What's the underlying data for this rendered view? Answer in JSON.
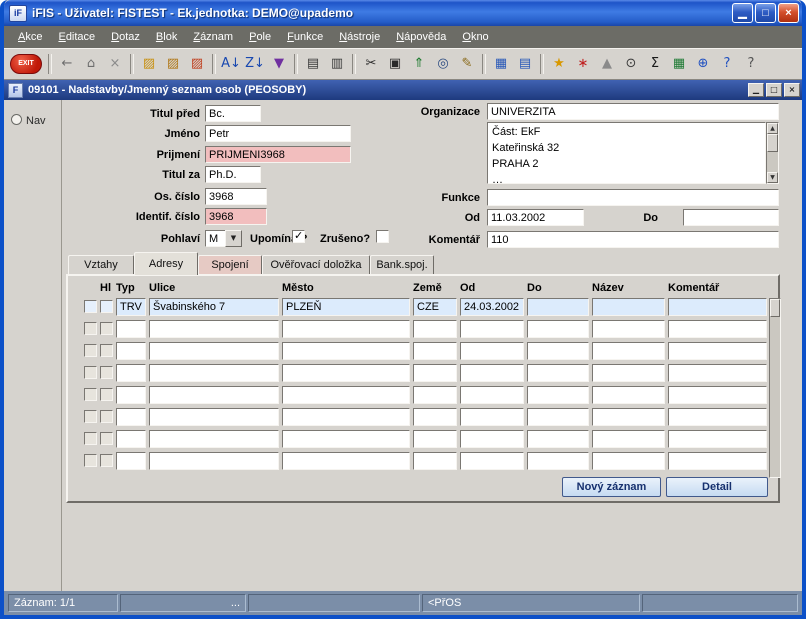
{
  "window": {
    "icon": "iF",
    "title": "iFIS - Uživatel: FISTEST - Ek.jednotka: DEMO@upademo",
    "minimize": "▁",
    "maximize": "□",
    "close": "×"
  },
  "menu": {
    "items": [
      "Akce",
      "Editace",
      "Dotaz",
      "Blok",
      "Záznam",
      "Pole",
      "Funkce",
      "Nástroje",
      "Nápověda",
      "Okno"
    ]
  },
  "toolbar": {
    "items": [
      {
        "name": "exit-button",
        "kind": "exit",
        "label": "EXIT"
      },
      {
        "sep": true
      },
      {
        "name": "back-icon",
        "glyph": "←",
        "color": "#6E6E6E"
      },
      {
        "name": "home-icon",
        "glyph": "⌂",
        "color": "#6E6E6E"
      },
      {
        "name": "clear-record-icon",
        "glyph": "×",
        "color": "#8A8A8A"
      },
      {
        "sep": true
      },
      {
        "name": "open-folder-icon",
        "glyph": "▨",
        "color": "#C89010"
      },
      {
        "name": "import-folder-icon",
        "glyph": "▨",
        "color": "#B07818"
      },
      {
        "name": "delete-folder-icon",
        "glyph": "▨",
        "color": "#C04020"
      },
      {
        "sep": true
      },
      {
        "name": "sort-asc-icon",
        "glyph": "A↓",
        "color": "#1848B0"
      },
      {
        "name": "sort-desc-icon",
        "glyph": "Z↓",
        "color": "#1848B0"
      },
      {
        "name": "filter-icon",
        "glyph": "▼",
        "color": "#7030A0"
      },
      {
        "sep": true
      },
      {
        "name": "print-icon",
        "glyph": "▤",
        "color": "#3A3A3A"
      },
      {
        "name": "print-setup-icon",
        "glyph": "▥",
        "color": "#3A3A3A"
      },
      {
        "sep": true
      },
      {
        "name": "cut-icon",
        "glyph": "✂",
        "color": "#2A2A2A"
      },
      {
        "name": "copy-icon",
        "glyph": "▣",
        "color": "#2A2A2A"
      },
      {
        "name": "paste-icon",
        "glyph": "⇑",
        "color": "#1E7A2E"
      },
      {
        "name": "zoom-icon",
        "glyph": "◎",
        "color": "#2A4A80"
      },
      {
        "name": "edit-icon",
        "glyph": "✎",
        "color": "#8A6A1A"
      },
      {
        "sep": true
      },
      {
        "name": "grid-view-icon",
        "glyph": "▦",
        "color": "#2858B8"
      },
      {
        "name": "list-view-icon",
        "glyph": "▤",
        "color": "#2858B8"
      },
      {
        "sep": true
      },
      {
        "name": "star-icon",
        "glyph": "★",
        "color": "#D89800"
      },
      {
        "name": "web-icon",
        "glyph": "∗",
        "color": "#C02020"
      },
      {
        "name": "pyramid-icon",
        "glyph": "▲",
        "color": "#8A8A8A"
      },
      {
        "name": "clock-icon",
        "glyph": "⊙",
        "color": "#3A3A3A"
      },
      {
        "name": "sigma-icon",
        "glyph": "Σ",
        "color": "#1A1A1A"
      },
      {
        "name": "excel-icon",
        "glyph": "▦",
        "color": "#1E7A34"
      },
      {
        "name": "globe-icon",
        "glyph": "⊕",
        "color": "#2050C0"
      },
      {
        "name": "help-icon",
        "glyph": "?",
        "color": "#2050C0"
      },
      {
        "name": "context-help-icon",
        "glyph": "?",
        "color": "#555555"
      }
    ]
  },
  "form_window": {
    "icon": "F",
    "title": "09101 - Nadstavby/Jmenný seznam osob (PEOSOBY)",
    "minimize": "▁",
    "restore": "□",
    "close": "×"
  },
  "nav": {
    "label": "Nav"
  },
  "fields": {
    "titul_pred": {
      "label": "Titul před",
      "value": "Bc."
    },
    "jmeno": {
      "label": "Jméno",
      "value": "Petr"
    },
    "prijmeni": {
      "label": "Prijmení",
      "value": "PRIJMENI3968"
    },
    "titul_za": {
      "label": "Titul za",
      "value": "Ph.D."
    },
    "os_cislo": {
      "label": "Os. číslo",
      "value": "3968"
    },
    "identif_cislo": {
      "label": "Identif. číslo",
      "value": "3968"
    },
    "pohlavi": {
      "label": "Pohlaví",
      "value": "M"
    },
    "upominat": {
      "label": "Upomínat?",
      "checked": true
    },
    "zruseno": {
      "label": "Zrušeno?",
      "checked": false
    },
    "organizace": {
      "label": "Organizace",
      "value": "UNIVERZITA",
      "text": "Část: EkF\nKateřinská 32\nPRAHA 2\n…"
    },
    "funkce": {
      "label": "Funkce",
      "value": ""
    },
    "od": {
      "label": "Od",
      "value": "11.03.2002"
    },
    "do": {
      "label": "Do",
      "value": ""
    },
    "komentar": {
      "label": "Komentář",
      "value": "110"
    }
  },
  "tabs": {
    "items": [
      {
        "label": "Vztahy"
      },
      {
        "label": "Adresy",
        "active": true
      },
      {
        "label": "Spojení",
        "tint": "#E6CAC4"
      },
      {
        "label": "Ověřovací doložka"
      },
      {
        "label": "Bank.spoj."
      }
    ]
  },
  "table": {
    "columns": [
      {
        "key": "hl",
        "label": "Hl"
      },
      {
        "key": "typ",
        "label": "Typ"
      },
      {
        "key": "ulice",
        "label": "Ulice"
      },
      {
        "key": "mesto",
        "label": "Město"
      },
      {
        "key": "zeme",
        "label": "Země"
      },
      {
        "key": "od",
        "label": "Od"
      },
      {
        "key": "do",
        "label": "Do"
      },
      {
        "key": "nazev",
        "label": "Název"
      },
      {
        "key": "komentar",
        "label": "Komentář"
      }
    ],
    "rows": [
      {
        "typ": "TRV",
        "ulice": "Švabinského 7",
        "mesto": "PLZEŇ",
        "zeme": "CZE",
        "od": "24.03.2002",
        "do": "",
        "nazev": "",
        "komentar": ""
      }
    ],
    "empty_row_count": 7
  },
  "buttons": {
    "new_record": "Nový záznam",
    "detail": "Detail"
  },
  "statusbar": {
    "record": "Záznam: 1/1",
    "ellipsis": "...",
    "mode": "<PřOS"
  },
  "colors": {
    "field_pink": "#F2BEBE",
    "row_selected": "#DCEBFC",
    "status_bg": "#7B8EA8",
    "titlebar_blue": "#2E5CC4",
    "form_titlebar": "#2A4694"
  }
}
